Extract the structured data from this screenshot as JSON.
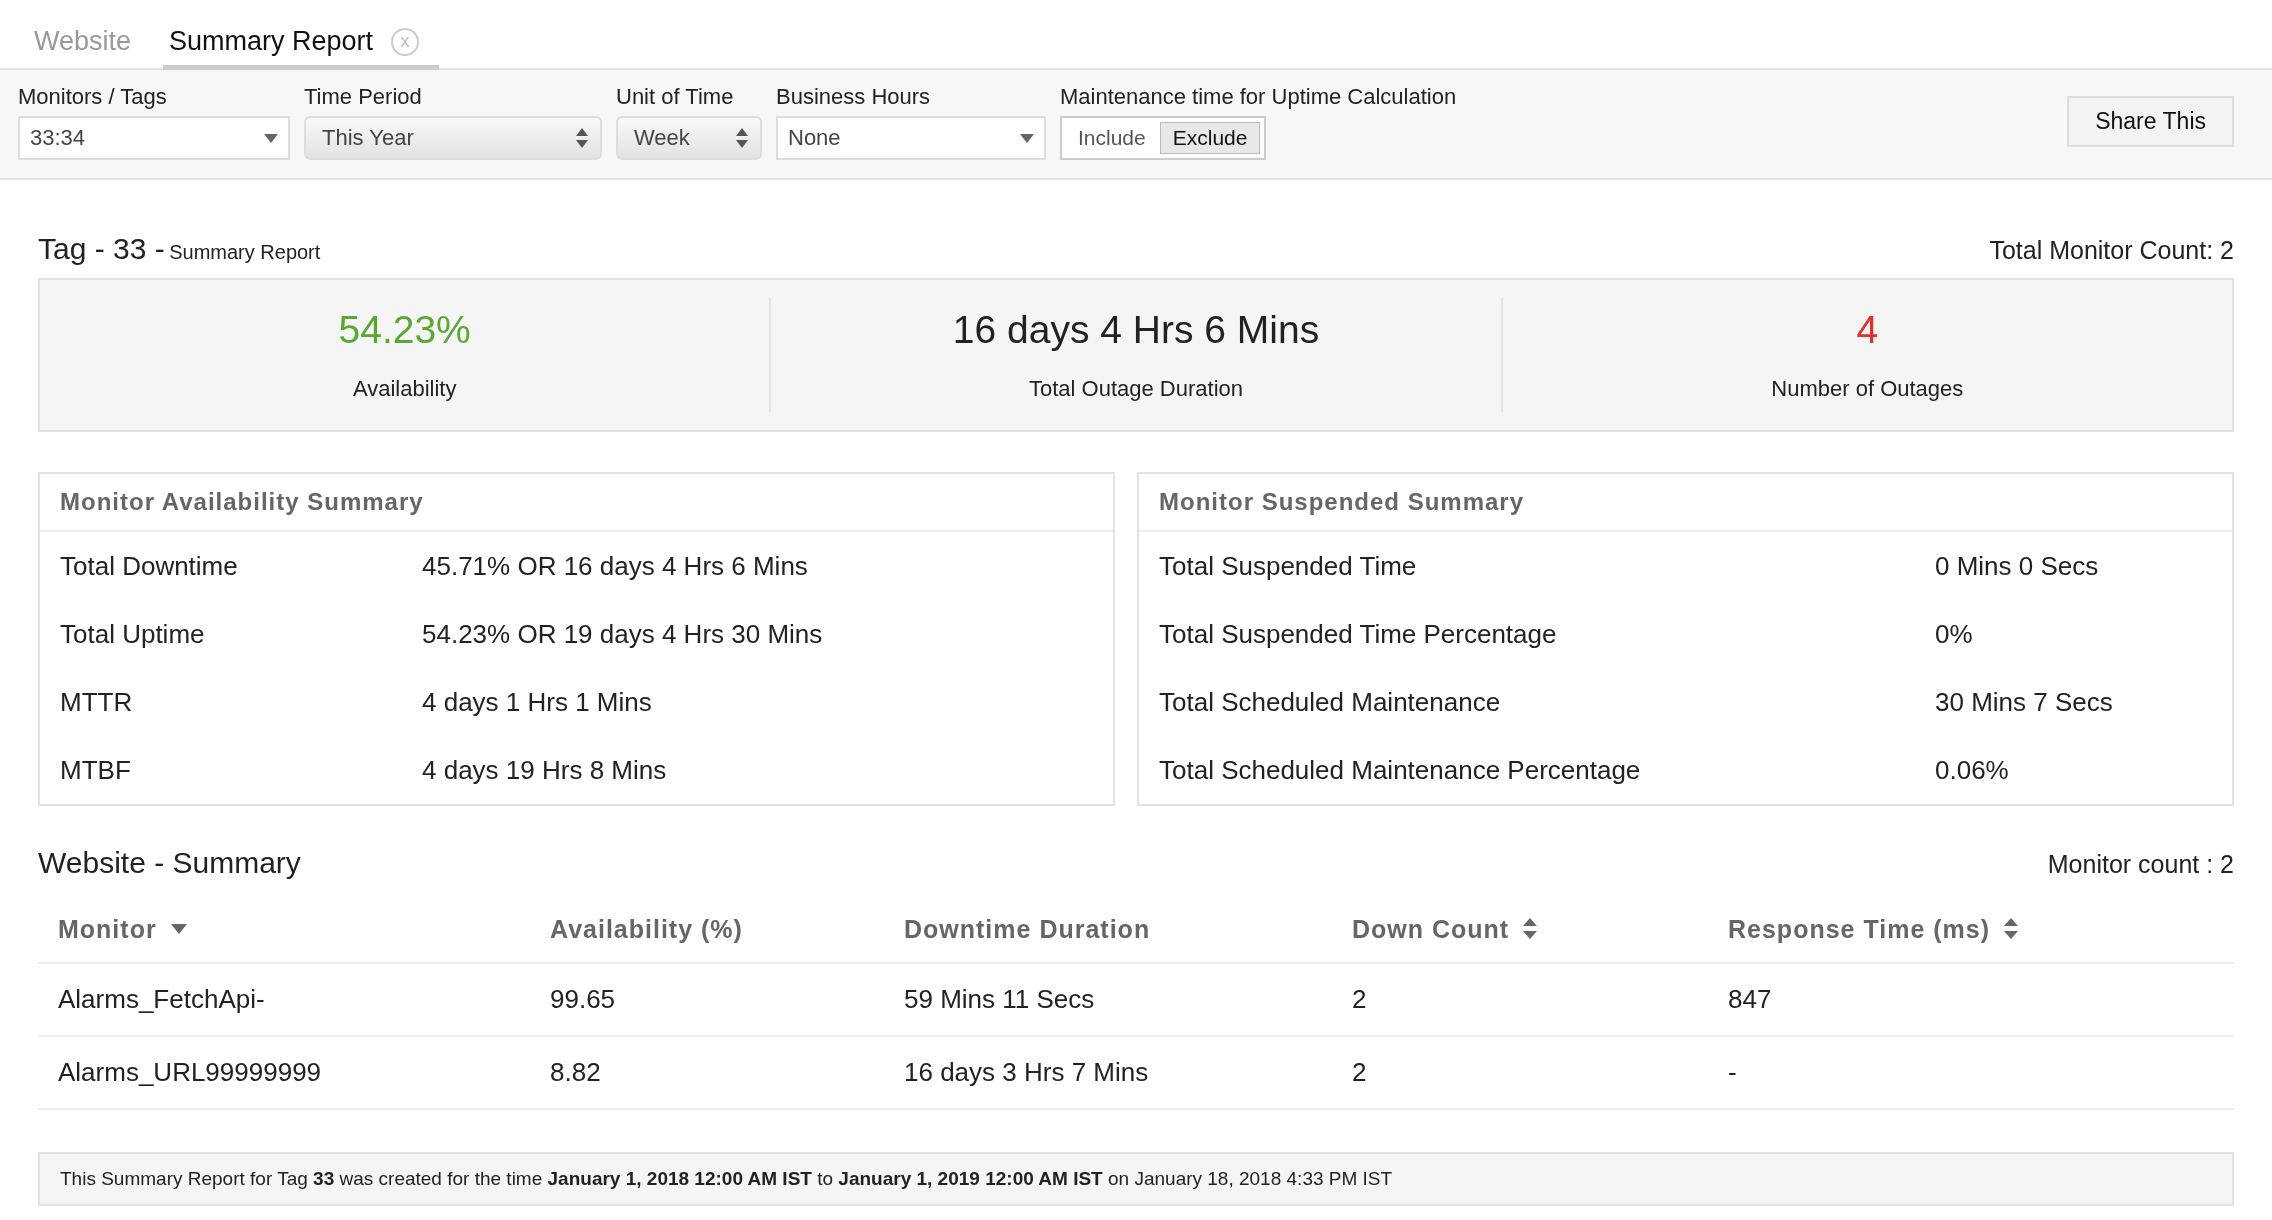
{
  "tabs": [
    {
      "label": "Website",
      "selected": false,
      "closable": false
    },
    {
      "label": "Summary Report",
      "selected": true,
      "closable": true,
      "close_glyph": "x"
    }
  ],
  "filters": [
    {
      "label": "Monitors / Tags",
      "kind": "select",
      "value": "33:34"
    },
    {
      "label": "Time Period",
      "kind": "spinner",
      "value": "This Year"
    },
    {
      "label": "Unit of Time",
      "kind": "spinner",
      "value": "Week"
    },
    {
      "label": "Business Hours",
      "kind": "select",
      "value": "None"
    }
  ],
  "maintenance": {
    "label": "Maintenance time for Uptime Calculation",
    "options": [
      {
        "label": "Include",
        "selected": false
      },
      {
        "label": "Exclude",
        "selected": true
      }
    ]
  },
  "share_button": "Share This",
  "report": {
    "title": "Tag - 33 -",
    "subtitle": "Summary Report",
    "total_count": "Total Monitor Count: 2"
  },
  "stats": [
    {
      "value": "54.23%",
      "label": "Availability",
      "color": "#5aa832"
    },
    {
      "value": "16 days 4 Hrs 6 Mins",
      "label": "Total Outage Duration",
      "color": "#222222"
    },
    {
      "value": "4",
      "label": "Number of Outages",
      "color": "#e0302a"
    }
  ],
  "panels": [
    {
      "title": "Monitor Availability Summary",
      "rows": [
        {
          "label": "Total Downtime",
          "value": "45.71% OR 16 days 4 Hrs 6 Mins"
        },
        {
          "label": "Total Uptime",
          "value": "54.23% OR 19 days 4 Hrs 30 Mins"
        },
        {
          "label": "MTTR",
          "value": "4 days 1 Hrs 1 Mins"
        },
        {
          "label": "MTBF",
          "value": "4 days 19 Hrs 8 Mins"
        }
      ]
    },
    {
      "title": "Monitor Suspended Summary",
      "rows": [
        {
          "label": "Total Suspended Time",
          "value": "0 Mins 0 Secs"
        },
        {
          "label": "Total Suspended Time Percentage",
          "value": "0%"
        },
        {
          "label": "Total Scheduled Maintenance",
          "value": "30 Mins 7 Secs"
        },
        {
          "label": "Total Scheduled Maintenance Percentage",
          "value": "0.06%"
        }
      ]
    }
  ],
  "summary": {
    "title": "Website - Summary",
    "count": "Monitor count : 2",
    "columns": [
      {
        "label": "Monitor",
        "kind": "dropdown"
      },
      {
        "label": "Availability (%)",
        "kind": "plain"
      },
      {
        "label": "Downtime Duration",
        "kind": "plain"
      },
      {
        "label": "Down Count",
        "kind": "sortable"
      },
      {
        "label": "Response Time (ms)",
        "kind": "sortable"
      }
    ],
    "rows": [
      [
        "Alarms_FetchApi-",
        "99.65",
        "59 Mins 11 Secs",
        "2",
        "847"
      ],
      [
        "Alarms_URL99999999",
        "8.82",
        "16 days 3 Hrs 7 Mins",
        "2",
        "-"
      ]
    ]
  },
  "footer": "This Summary Report for Tag **33** was created for the time **January 1, 2018 12:00 AM IST** to **January 1, 2019 12:00 AM IST** on January 18, 2018 4:33 PM IST"
}
